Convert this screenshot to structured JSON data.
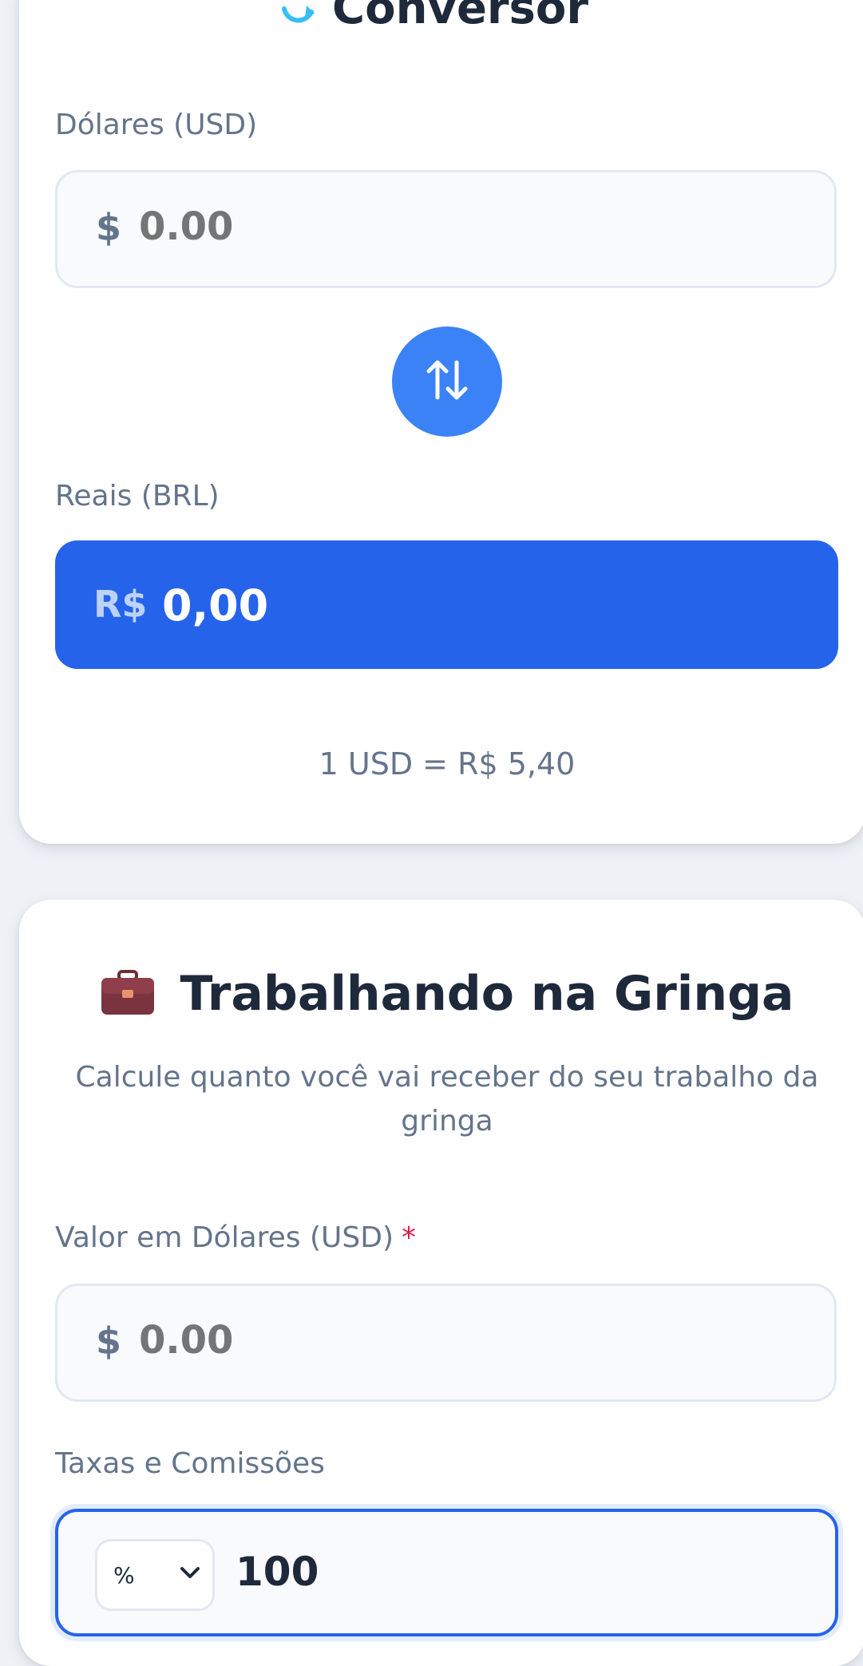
{
  "converter": {
    "title": "Conversor",
    "usd_label": "Dólares (USD)",
    "usd_prefix": "$",
    "usd_placeholder": "0.00",
    "brl_label": "Reais (BRL)",
    "brl_prefix": "R$",
    "brl_value": "0,00",
    "rate_text": "1 USD = R$ 5,40",
    "swap_icon": "swap-vertical-arrows",
    "colors": {
      "accent": "#3b82f6",
      "result_bg": "#2563eb"
    }
  },
  "abroad": {
    "icon": "briefcase",
    "title": "Trabalhando na Gringa",
    "subtitle": "Calcule quanto você vai receber do seu trabalho da gringa",
    "usd_label": "Valor em Dólares (USD)",
    "required_mark": "*",
    "usd_prefix": "$",
    "usd_placeholder": "0.00",
    "fees_label": "Taxas e Comissões",
    "fees_type": "%",
    "fees_value": "100"
  }
}
